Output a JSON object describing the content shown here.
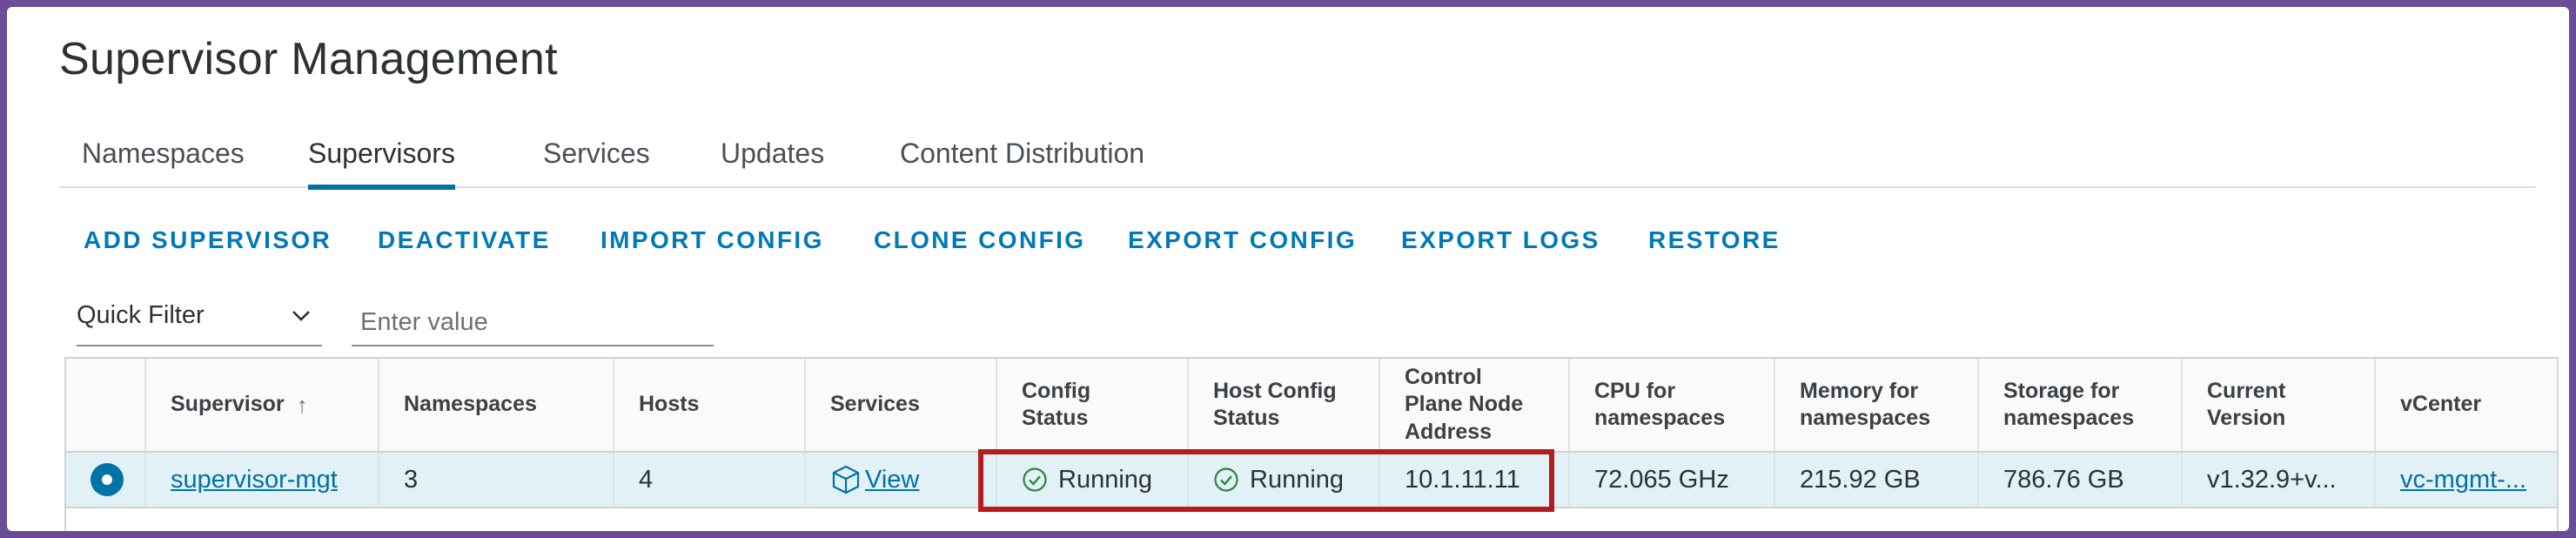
{
  "page": {
    "title": "Supervisor Management"
  },
  "tabs": [
    {
      "label": "Namespaces",
      "active": false
    },
    {
      "label": "Supervisors",
      "active": true
    },
    {
      "label": "Services",
      "active": false
    },
    {
      "label": "Updates",
      "active": false
    },
    {
      "label": "Content Distribution",
      "active": false
    }
  ],
  "actions": [
    "ADD SUPERVISOR",
    "DEACTIVATE",
    "IMPORT CONFIG",
    "CLONE CONFIG",
    "EXPORT CONFIG",
    "EXPORT LOGS",
    "RESTORE"
  ],
  "filter": {
    "select_label": "Quick Filter",
    "input_placeholder": "Enter value",
    "input_value": ""
  },
  "table": {
    "columns": [
      "Supervisor",
      "Namespaces",
      "Hosts",
      "Services",
      "Config\nStatus",
      "Host Config\nStatus",
      "Control\nPlane Node\nAddress",
      "CPU for\nnamespaces",
      "Memory for\nnamespaces",
      "Storage for\nnamespaces",
      "Current\nVersion",
      "vCenter"
    ],
    "rows": [
      {
        "selected": true,
        "supervisor": "supervisor-mgt",
        "namespaces": "3",
        "hosts": "4",
        "services": "View",
        "config_status": "Running",
        "host_config_status": "Running",
        "control_plane_address": "10.1.11.11",
        "cpu": "72.065 GHz",
        "memory": "215.92 GB",
        "storage": "786.76 GB",
        "version": "v1.32.9+v...",
        "vcenter": "vc-mgmt-..."
      }
    ]
  },
  "colors": {
    "accent": "#0072a3",
    "action": "#0079b8",
    "highlight": "#b71c1c",
    "status_ok": "#2e8540",
    "frame": "#6b4c96"
  }
}
